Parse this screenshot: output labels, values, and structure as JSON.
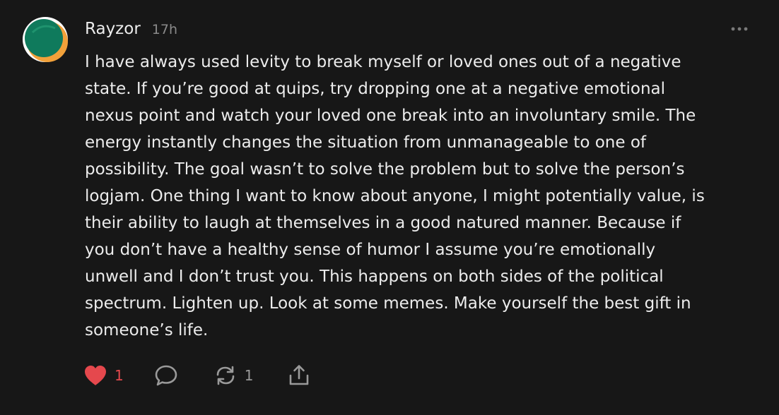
{
  "comment": {
    "author": "Rayzor",
    "time_ago": "17h",
    "body_lines": [
      "I have always used levity to break myself or loved ones out of a negative",
      "state. If you’re good at quips, try dropping one at a negative emotional",
      "nexus point and watch your loved one break into an involuntary smile. The",
      "energy instantly changes the situation from unmanageable to one of",
      "possibility. The goal wasn’t to solve the problem but to solve the person’s",
      "logjam. One thing I want to know about anyone, I might potentially value, is",
      "their ability to laugh at themselves in a good natured manner. Because if",
      "you don’t have a healthy sense of humor I assume you’re emotionally",
      "unwell and I don’t trust you. This happens on both sides of the political",
      "spectrum. Lighten up. Look at some memes. Make yourself the best gift in",
      "someone’s life."
    ],
    "actions": {
      "like_count": "1",
      "restack_count": "1"
    }
  },
  "icons": {
    "avatar": "avatar-icon",
    "more": "more-horizontal-icon",
    "like": "heart-icon",
    "reply": "speech-bubble-icon",
    "restack": "restack-arrows-icon",
    "share": "share-icon"
  },
  "colors": {
    "background": "#171717",
    "text": "#ececec",
    "muted": "#8a8a8a",
    "like_red": "#e5484d",
    "avatar_teal": "#0f7a5c",
    "avatar_orange": "#f2a13a"
  }
}
